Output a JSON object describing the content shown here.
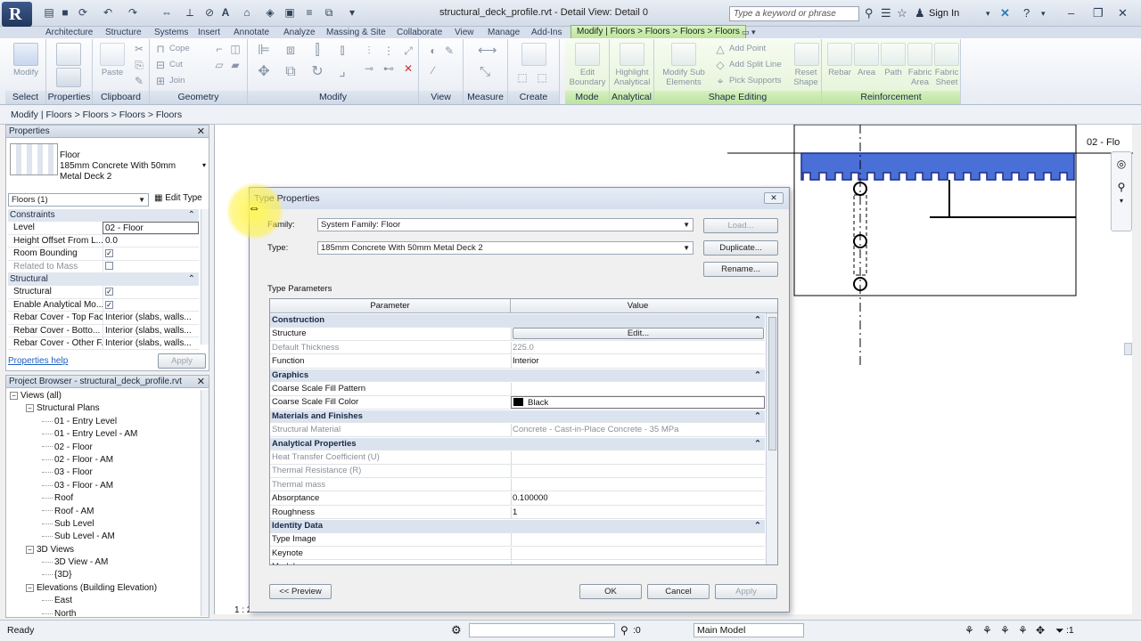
{
  "titlebar": {
    "app_logo": "R",
    "doc_title": "structural_deck_profile.rvt - Detail View: Detail 0",
    "search_placeholder": "Type a keyword or phrase",
    "sign_in": "Sign In"
  },
  "ribbon_tabs": [
    "Architecture",
    "Structure",
    "Systems",
    "Insert",
    "Annotate",
    "Analyze",
    "Massing & Site",
    "Collaborate",
    "View",
    "Manage",
    "Add-Ins"
  ],
  "active_tab": "Modify | Floors > Floors > Floors > Floors",
  "ribbon": {
    "select": {
      "tool": "Modify",
      "title": "Select"
    },
    "properties": {
      "title": "Properties"
    },
    "clipboard": {
      "paste": "Paste",
      "title": "Clipboard"
    },
    "geometry": {
      "cope": "Cope",
      "cut": "Cut",
      "join": "Join",
      "title": "Geometry"
    },
    "modify": {
      "title": "Modify"
    },
    "view": {
      "title": "View"
    },
    "measure": {
      "title": "Measure"
    },
    "create": {
      "title": "Create"
    },
    "mode": {
      "tool": "Edit Boundary",
      "title": "Mode"
    },
    "analytical": {
      "tool": "Highlight Analytical",
      "title": "Analytical"
    },
    "shape_editing": {
      "tool": "Modify Sub Elements",
      "add_point": "Add Point",
      "add_split": "Add Split Line",
      "pick_supports": "Pick Supports",
      "reset": "Reset Shape",
      "title": "Shape Editing"
    },
    "reinforcement": {
      "items": [
        "Rebar",
        "Area",
        "Path",
        "Fabric Area",
        "Fabric Sheet"
      ],
      "title": "Reinforcement"
    }
  },
  "options_bar": "Modify | Floors > Floors > Floors > Floors",
  "properties_pane": {
    "title": "Properties",
    "type_family": "Floor",
    "type_name": "185mm Concrete With 50mm Metal Deck 2",
    "selector": "Floors (1)",
    "edit_type": "Edit Type",
    "rows": [
      {
        "group": true,
        "label": "Constraints"
      },
      {
        "label": "Level",
        "value": "02 - Floor"
      },
      {
        "label": "Height Offset From L...",
        "value": "0.0"
      },
      {
        "label": "Room Bounding",
        "check": true
      },
      {
        "label": "Related to Mass",
        "check": false,
        "dim": true
      },
      {
        "group": true,
        "label": "Structural"
      },
      {
        "label": "Structural",
        "check": true
      },
      {
        "label": "Enable Analytical Mo...",
        "check": true
      },
      {
        "label": "Rebar Cover - Top Face",
        "value": "Interior (slabs, walls..."
      },
      {
        "label": "Rebar Cover - Botto...",
        "value": "Interior (slabs, walls..."
      },
      {
        "label": "Rebar Cover - Other F...",
        "value": "Interior (slabs, walls..."
      }
    ],
    "help_link": "Properties help",
    "apply": "Apply"
  },
  "project_browser": {
    "title": "Project Browser - structural_deck_profile.rvt",
    "items": [
      {
        "label": "Views (all)",
        "level": 0,
        "toggle": "−"
      },
      {
        "label": "Structural Plans",
        "level": 1,
        "toggle": "−"
      },
      {
        "label": "01 - Entry Level",
        "level": 2
      },
      {
        "label": "01 - Entry Level - AM",
        "level": 2
      },
      {
        "label": "02 - Floor",
        "level": 2
      },
      {
        "label": "02 - Floor - AM",
        "level": 2
      },
      {
        "label": "03 - Floor",
        "level": 2
      },
      {
        "label": "03 - Floor - AM",
        "level": 2
      },
      {
        "label": "Roof",
        "level": 2
      },
      {
        "label": "Roof - AM",
        "level": 2
      },
      {
        "label": "Sub Level",
        "level": 2
      },
      {
        "label": "Sub Level - AM",
        "level": 2
      },
      {
        "label": "3D Views",
        "level": 1,
        "toggle": "−"
      },
      {
        "label": "3D View - AM",
        "level": 2
      },
      {
        "label": "{3D}",
        "level": 2
      },
      {
        "label": "Elevations (Building Elevation)",
        "level": 1,
        "toggle": "−"
      },
      {
        "label": "East",
        "level": 2
      },
      {
        "label": "North",
        "level": 2
      }
    ]
  },
  "canvas": {
    "level_tag": "02 - Flo",
    "scale": "1 : 2"
  },
  "dialog": {
    "title": "Type Properties",
    "family_label": "Family:",
    "family_value": "System Family: Floor",
    "type_label": "Type:",
    "type_value": "185mm Concrete With 50mm Metal Deck 2",
    "load": "Load...",
    "duplicate": "Duplicate...",
    "rename": "Rename...",
    "params_label": "Type Parameters",
    "col_param": "Parameter",
    "col_value": "Value",
    "rows": [
      {
        "group": true,
        "label": "Construction"
      },
      {
        "label": "Structure",
        "value": "Edit...",
        "button": true
      },
      {
        "label": "Default Thickness",
        "value": "225.0",
        "dim": true
      },
      {
        "label": "Function",
        "value": "Interior"
      },
      {
        "group": true,
        "label": "Graphics"
      },
      {
        "label": "Coarse Scale Fill Pattern",
        "value": ""
      },
      {
        "label": "Coarse Scale Fill Color",
        "value": "Black",
        "swatch": "#000000"
      },
      {
        "group": true,
        "label": "Materials and Finishes"
      },
      {
        "label": "Structural Material",
        "value": "Concrete - Cast-in-Place Concrete - 35 MPa",
        "dim": true
      },
      {
        "group": true,
        "label": "Analytical Properties"
      },
      {
        "label": "Heat Transfer Coefficient (U)",
        "value": "",
        "dim": true
      },
      {
        "label": "Thermal Resistance (R)",
        "value": "",
        "dim": true
      },
      {
        "label": "Thermal mass",
        "value": "",
        "dim": true
      },
      {
        "label": "Absorptance",
        "value": "0.100000"
      },
      {
        "label": "Roughness",
        "value": "1"
      },
      {
        "group": true,
        "label": "Identity Data"
      },
      {
        "label": "Type Image",
        "value": ""
      },
      {
        "label": "Keynote",
        "value": ""
      },
      {
        "label": "Model",
        "value": ""
      }
    ],
    "preview": "<< Preview",
    "ok": "OK",
    "cancel": "Cancel",
    "apply": "Apply"
  },
  "statusbar": {
    "text": "Ready",
    "filter_count": ":0",
    "model": "Main Model",
    "selection_count": ":1"
  },
  "colors": {
    "accent_green": "#bfe59d",
    "deck_blue": "#4a6fd6"
  }
}
